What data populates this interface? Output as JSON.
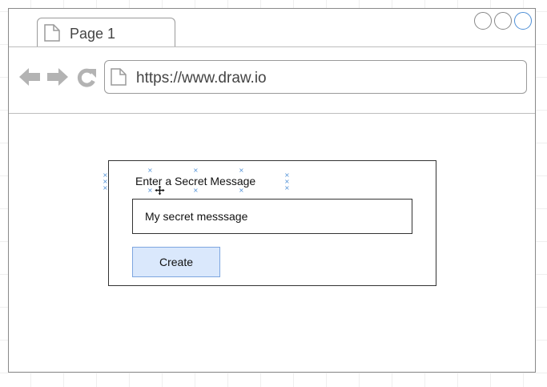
{
  "browser": {
    "tab": {
      "title": "Page 1",
      "icon": "document-icon"
    },
    "window_controls": [
      "minimize-circle",
      "restore-circle",
      "maximize-circle"
    ],
    "nav": {
      "back_icon": "arrow-left-icon",
      "forward_icon": "arrow-right-icon",
      "reload_icon": "reload-icon"
    },
    "address": {
      "url": "https://www.draw.io",
      "icon": "document-icon"
    }
  },
  "form": {
    "label": "Enter a Secret Message",
    "input_value": "My secret messsage",
    "button_label": "Create"
  },
  "colors": {
    "button_fill": "#dae8fc",
    "button_border": "#7ea6e0",
    "selection_handles": "#4e8fd6",
    "chrome_icon": "#b3b3b3"
  }
}
